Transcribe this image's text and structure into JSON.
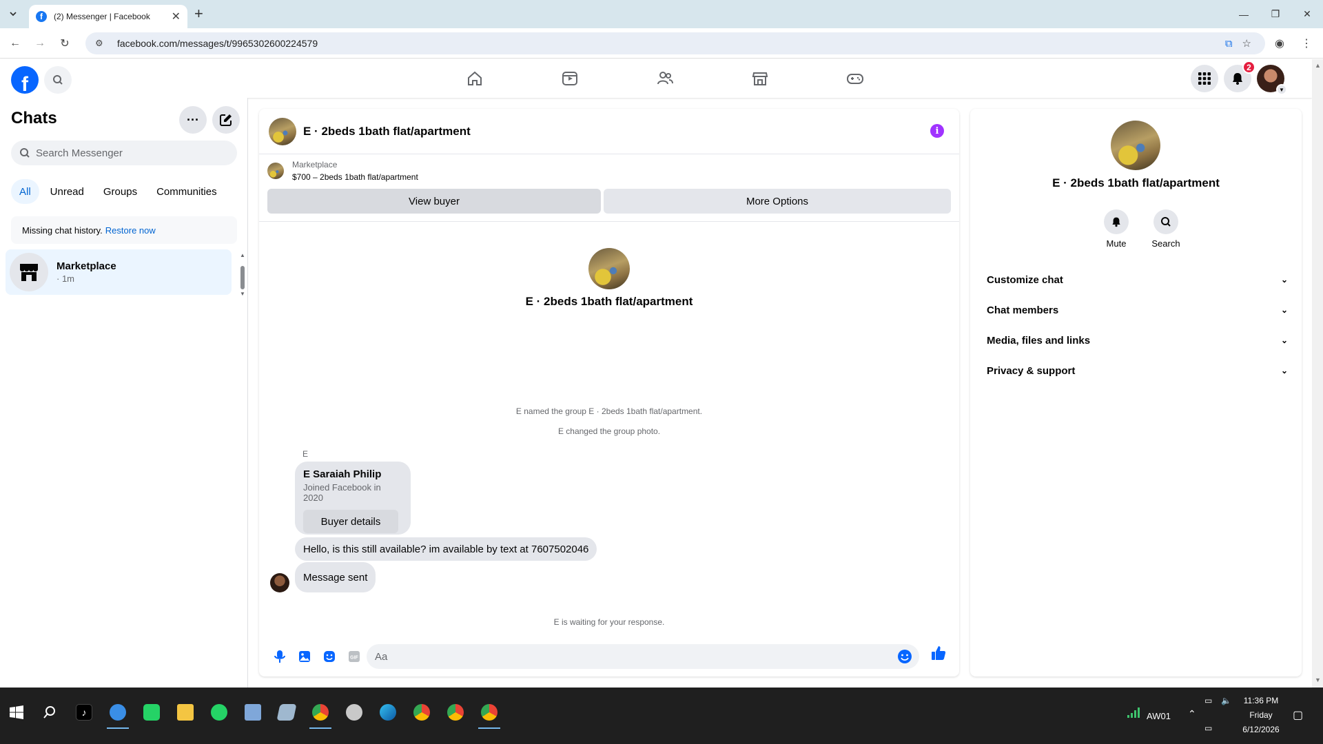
{
  "browser": {
    "tab_title": "(2) Messenger | Facebook",
    "url": "facebook.com/messages/t/9965302600224579",
    "colors": {
      "tabbar": "#d7e6ed",
      "omnibox": "#e9eef6"
    }
  },
  "fb_header": {
    "logo_letter": "f",
    "notifications_count": "2",
    "nav_icons": [
      "home-icon",
      "video-icon",
      "friends-icon",
      "marketplace-icon",
      "gaming-icon"
    ],
    "brand_color": "#0866ff"
  },
  "chats_panel": {
    "title": "Chats",
    "search_placeholder": "Search Messenger",
    "filters": [
      "All",
      "Unread",
      "Groups",
      "Communities"
    ],
    "active_filter": "All",
    "missing_history_text": "Missing chat history.",
    "restore_link": "Restore now",
    "items": [
      {
        "name": "Marketplace",
        "time": "· 1m"
      }
    ]
  },
  "conversation": {
    "title": "E · 2beds 1bath flat/apartment",
    "marketplace_label": "Marketplace",
    "listing": "$700 – 2beds 1bath flat/apartment",
    "view_buyer_label": "View buyer",
    "more_options_label": "More Options",
    "intro_name": "E · 2beds 1bath flat/apartment",
    "system_messages": [
      "E named the group E · 2beds 1bath flat/apartment.",
      "E changed the group photo."
    ],
    "sender_label": "E",
    "buyer_card": {
      "name": "E Saraiah Philip",
      "joined": "Joined Facebook in 2020",
      "button": "Buyer details"
    },
    "messages": [
      "Hello, is this still available? im available by text at 7607502046",
      "Message sent"
    ],
    "waiting_text": "E is waiting for your response.",
    "composer_placeholder": "Aa"
  },
  "details_panel": {
    "name": "E · 2beds 1bath flat/apartment",
    "actions": [
      "Mute",
      "Search"
    ],
    "sections": [
      "Customize chat",
      "Chat members",
      "Media, files and links",
      "Privacy & support"
    ]
  },
  "taskbar": {
    "network_label": "AW01",
    "time": "11:36 PM",
    "day": "Friday",
    "date": "6/12/2026"
  }
}
